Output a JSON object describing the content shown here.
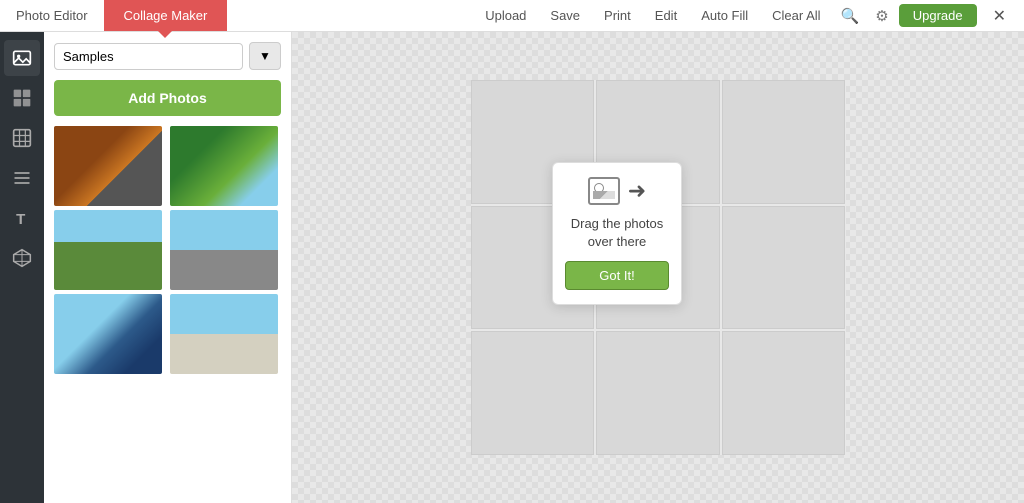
{
  "tabs": {
    "photo_editor": "Photo Editor",
    "collage_maker": "Collage Maker"
  },
  "nav": {
    "upload": "Upload",
    "save": "Save",
    "print": "Print",
    "edit": "Edit",
    "auto_fill": "Auto Fill",
    "clear_all": "Clear All",
    "upgrade": "Upgrade"
  },
  "panel": {
    "dropdown_label": "Samples",
    "add_photos_label": "Add Photos"
  },
  "tooltip": {
    "message": "Drag the photos over there",
    "got_it": "Got It!"
  },
  "sidebar_icons": [
    {
      "name": "image-icon",
      "unicode": "🖼"
    },
    {
      "name": "grid-icon",
      "unicode": "▦"
    },
    {
      "name": "table-icon",
      "unicode": "⊞"
    },
    {
      "name": "list-icon",
      "unicode": "≡"
    },
    {
      "name": "text-icon",
      "unicode": "T"
    },
    {
      "name": "cube-icon",
      "unicode": "◆"
    }
  ]
}
